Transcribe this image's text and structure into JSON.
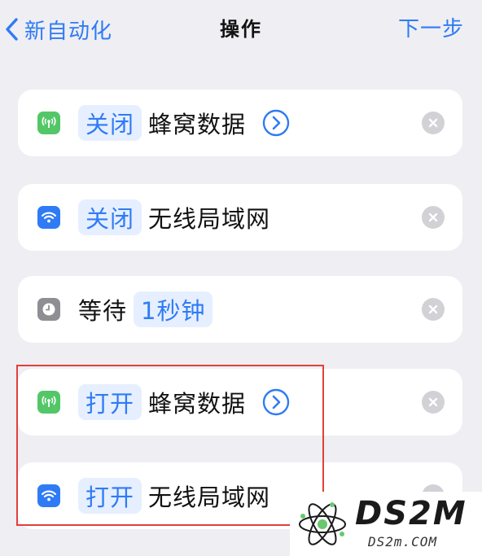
{
  "nav": {
    "back_label": "新自动化",
    "title": "操作",
    "next_label": "下一步"
  },
  "actions": [
    {
      "token": "关闭",
      "label": "蜂窝数据",
      "icon": "cellular-icon",
      "has_detail": true
    },
    {
      "token": "关闭",
      "label": "无线局域网",
      "icon": "wifi-icon",
      "has_detail": false
    },
    {
      "prefix": "等待",
      "token": "1秒钟",
      "icon": "clock-icon",
      "has_detail": false
    },
    {
      "token": "打开",
      "label": "蜂窝数据",
      "icon": "cellular-icon",
      "has_detail": true
    },
    {
      "token": "打开",
      "label": "无线局域网",
      "icon": "wifi-icon",
      "has_detail": false
    }
  ],
  "watermark": {
    "title": "DS2M",
    "subtitle": "DS2m.COM"
  },
  "colors": {
    "accent": "#2f7bf5",
    "green": "#53c767",
    "gray_icon": "#8e8e93",
    "highlight": "#e0403c",
    "background": "#eeeef3"
  }
}
